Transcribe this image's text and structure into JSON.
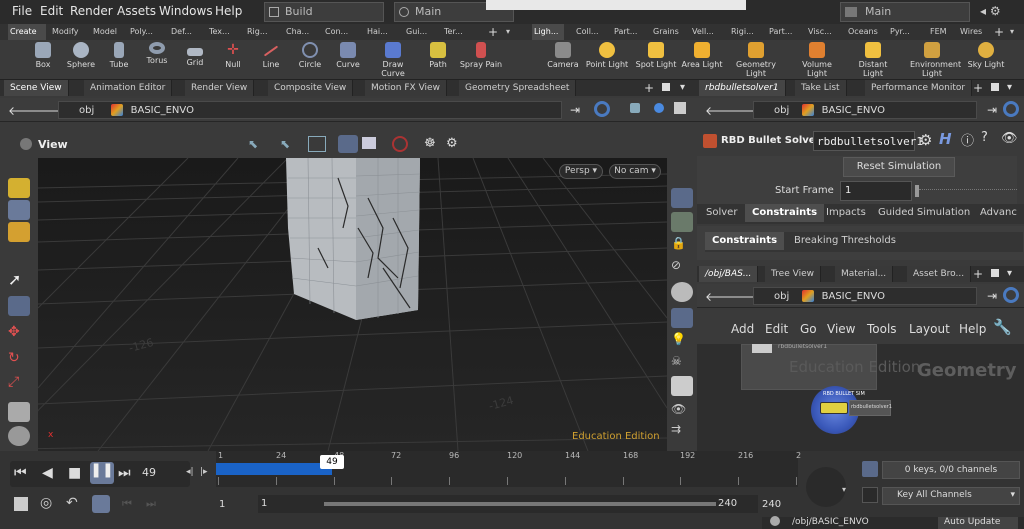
{
  "menu": {
    "items": [
      "File",
      "Edit",
      "Render",
      "Assets",
      "Windows",
      "Help"
    ],
    "desktop_left": "Build",
    "desktop_mid": "Main",
    "desktop_right": "Main"
  },
  "shelf_tabs_left": [
    "Create",
    "Modify",
    "Model",
    "Poly...",
    "Def...",
    "Tex...",
    "Rig...",
    "Cha...",
    "Con...",
    "Hai...",
    "Gui...",
    "Ter..."
  ],
  "shelf_tabs_right": [
    "Ligh...",
    "Coll...",
    "Part...",
    "Grains",
    "Vell...",
    "Rigi...",
    "Part...",
    "Visc...",
    "Oceans",
    "Pyr...",
    "FEM",
    "Wires"
  ],
  "shelf_tools_left": [
    {
      "label": "Box",
      "color": "#9aa7b8"
    },
    {
      "label": "Sphere",
      "color": "#aab5c4"
    },
    {
      "label": "Tube",
      "color": "#9aa7b8"
    },
    {
      "label": "Torus",
      "color": "#8f9cae"
    },
    {
      "label": "Grid",
      "color": "#b0b8c4"
    },
    {
      "label": "Null",
      "color": "#e05050"
    },
    {
      "label": "Line",
      "color": "#d86060"
    },
    {
      "label": "Circle",
      "color": "#8090b0"
    },
    {
      "label": "Curve",
      "color": "#7a8ab0"
    },
    {
      "label": "Draw Curve",
      "color": "#5a7ad0"
    },
    {
      "label": "Path",
      "color": "#d8c040"
    },
    {
      "label": "Spray Pain",
      "color": "#d05050"
    }
  ],
  "shelf_tools_right": [
    {
      "label": "Camera",
      "color": "#8a8a8a"
    },
    {
      "label": "Point Light",
      "color": "#f0c040"
    },
    {
      "label": "Spot Light",
      "color": "#f0c040"
    },
    {
      "label": "Area Light",
      "color": "#f0b030"
    },
    {
      "label": "Geometry Light",
      "color": "#e0a030"
    },
    {
      "label": "Volume Light",
      "color": "#e08030"
    },
    {
      "label": "Distant Light",
      "color": "#f0c040"
    },
    {
      "label": "Environment Light",
      "color": "#d0a040"
    },
    {
      "label": "Sky Light",
      "color": "#e0b040"
    }
  ],
  "pane_tabs": [
    "Scene View",
    "Animation Editor",
    "Render View",
    "Composite View",
    "Motion FX View",
    "Geometry Spreadsheet"
  ],
  "right_pane_tabs": [
    "rbdbulletsolver1",
    "Take List",
    "Performance Monitor"
  ],
  "path": {
    "root": "obj",
    "node": "BASIC_ENVO"
  },
  "viewport": {
    "title": "View",
    "persp": "Persp",
    "cam": "No cam",
    "watermark": "Education Edition",
    "axis": "x"
  },
  "playbar": {
    "current_frame": "49",
    "ticks": [
      "1",
      "24",
      "48",
      "72",
      "96",
      "120",
      "144",
      "168",
      "192",
      "216",
      "2"
    ],
    "marker": "49",
    "range_start": "1",
    "range_start2": "1",
    "range_end": "240",
    "range_end2": "240",
    "played_fraction": 0.2,
    "keys_label": "0 keys, 0/0 channels",
    "key_all_label": "Key All Channels"
  },
  "params": {
    "node_type": "RBD Bullet Solver",
    "node_name": "rbdbulletsolver1",
    "reset_label": "Reset Simulation",
    "start_frame_label": "Start Frame",
    "start_frame_value": "1",
    "tabs": [
      "Solver",
      "Constraints",
      "Impacts",
      "Guided Simulation",
      "Advanc"
    ],
    "subtabs": [
      "Constraints",
      "Breaking Thresholds"
    ]
  },
  "network": {
    "tabs": [
      "/obj/BAS...",
      "Tree View",
      "Material...",
      "Asset Bro..."
    ],
    "menu": [
      "Add",
      "Edit",
      "Go",
      "View",
      "Tools",
      "Layout",
      "Help"
    ],
    "watermark": "Education Edition",
    "context": "Geometry",
    "node_title": "RBD BULLET SIM",
    "node_label": "rbdbulletsolver1",
    "bottom_path": "/obj/BASIC_ENVO",
    "bottom_btn": "Auto Update"
  }
}
